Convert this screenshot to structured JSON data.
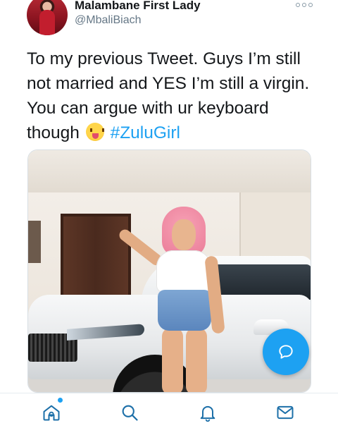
{
  "tweet": {
    "author": {
      "display_name": "Malambane First Lady",
      "handle": "@MbaliBiach",
      "avatar_icon": "profile-photo"
    },
    "text_before_emoji": "To my previous Tweet. Guys I’m still not married and YES I’m still a virgin. You can argue with ur keyboard though ",
    "emoji_icon": "squinting-face-with-tongue-emoji",
    "hashtag": "#ZuluGirl",
    "more_icon": "more-options-icon",
    "media": {
      "kind": "photo",
      "description_icon": "tweet-photo"
    }
  },
  "fab": {
    "icon": "compose-message-icon",
    "color": "#1da1f2"
  },
  "bottom_nav": {
    "items": [
      {
        "icon": "home-icon",
        "has_notification": true
      },
      {
        "icon": "search-icon"
      },
      {
        "icon": "notifications-bell-icon"
      },
      {
        "icon": "messages-mail-icon"
      }
    ]
  },
  "colors": {
    "link": "#1da1f2",
    "text": "#14171a",
    "secondary": "#657786",
    "icon": "#1c6fa8"
  }
}
